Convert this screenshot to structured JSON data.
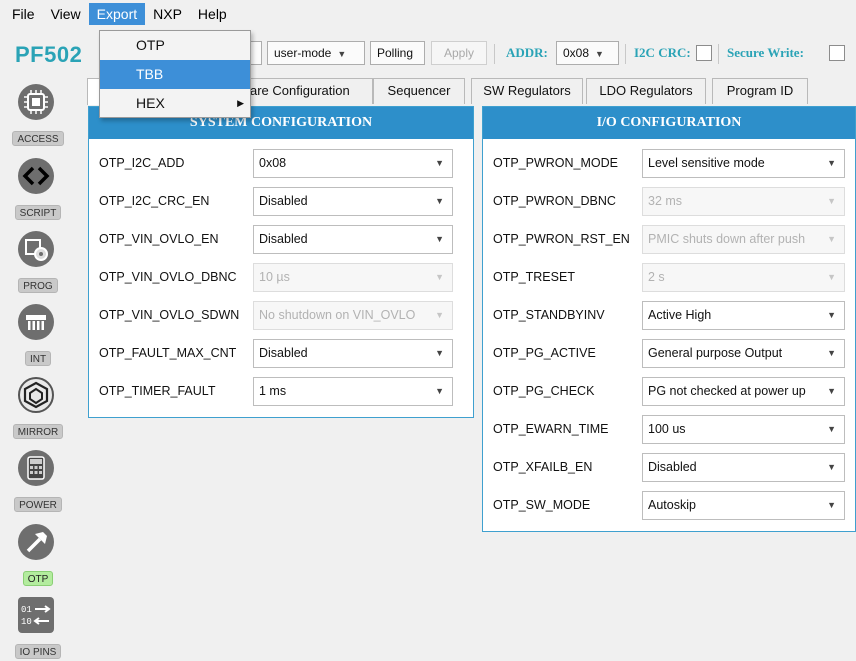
{
  "menu": {
    "items": [
      "File",
      "View",
      "Export",
      "NXP",
      "Help"
    ],
    "active": "Export"
  },
  "export_menu": {
    "items": [
      {
        "label": "OTP",
        "highlighted": false,
        "submenu": false
      },
      {
        "label": "TBB",
        "highlighted": true,
        "submenu": false
      },
      {
        "label": "HEX",
        "highlighted": false,
        "submenu": true
      }
    ]
  },
  "toolbar": {
    "brand": "PF502",
    "mode_select": "user-mode",
    "polling_button": "Polling",
    "apply_button": "Apply",
    "addr_label": "ADDR:",
    "addr_value": "0x08",
    "i2c_crc_label": "I2C CRC:",
    "i2c_crc_checked": false,
    "secure_write_label": "Secure Write:",
    "secure_write_checked": false
  },
  "sidebar": {
    "items": [
      {
        "label": "ACCESS",
        "icon": "chip-icon",
        "selected": false
      },
      {
        "label": "SCRIPT",
        "icon": "code-brackets-icon",
        "selected": false
      },
      {
        "label": "PROG",
        "icon": "gear-chip-icon",
        "selected": false
      },
      {
        "label": "INT",
        "icon": "pins-icon",
        "selected": false
      },
      {
        "label": "MIRROR",
        "icon": "mirror-icon",
        "selected": false
      },
      {
        "label": "POWER",
        "icon": "calculator-icon",
        "selected": false
      },
      {
        "label": "OTP",
        "icon": "hammer-icon",
        "selected": true
      },
      {
        "label": "IO PINS",
        "icon": "io-arrows-icon",
        "selected": false
      }
    ]
  },
  "tabs": [
    {
      "label": "",
      "active": true
    },
    {
      "label": "are Configuration",
      "active": false
    },
    {
      "label": "Sequencer",
      "active": false
    },
    {
      "label": "SW Regulators",
      "active": false
    },
    {
      "label": "LDO Regulators",
      "active": false
    },
    {
      "label": "Program ID",
      "active": false
    }
  ],
  "system_config": {
    "title": "SYSTEM CONFIGURATION",
    "rows": [
      {
        "label": "OTP_I2C_ADD",
        "value": "0x08",
        "enabled": true
      },
      {
        "label": "OTP_I2C_CRC_EN",
        "value": "Disabled",
        "enabled": true
      },
      {
        "label": "OTP_VIN_OVLO_EN",
        "value": "Disabled",
        "enabled": true
      },
      {
        "label": "OTP_VIN_OVLO_DBNC",
        "value": "10 µs",
        "enabled": false
      },
      {
        "label": "OTP_VIN_OVLO_SDWN",
        "value": "No shutdown on VIN_OVLO",
        "enabled": false
      },
      {
        "label": "OTP_FAULT_MAX_CNT",
        "value": "Disabled",
        "enabled": true
      },
      {
        "label": "OTP_TIMER_FAULT",
        "value": "1 ms",
        "enabled": true
      }
    ]
  },
  "io_config": {
    "title": "I/O CONFIGURATION",
    "rows": [
      {
        "label": "OTP_PWRON_MODE",
        "value": "Level sensitive mode",
        "enabled": true
      },
      {
        "label": "OTP_PWRON_DBNC",
        "value": "32 ms",
        "enabled": false
      },
      {
        "label": "OTP_PWRON_RST_EN",
        "value": "PMIC shuts down after push",
        "enabled": false
      },
      {
        "label": "OTP_TRESET",
        "value": "2 s",
        "enabled": false
      },
      {
        "label": "OTP_STANDBYINV",
        "value": "Active High",
        "enabled": true
      },
      {
        "label": "OTP_PG_ACTIVE",
        "value": "General purpose Output",
        "enabled": true
      },
      {
        "label": "OTP_PG_CHECK",
        "value": "PG not checked at power up",
        "enabled": true
      },
      {
        "label": "OTP_EWARN_TIME",
        "value": "100 us",
        "enabled": true
      },
      {
        "label": "OTP_XFAILB_EN",
        "value": "Disabled",
        "enabled": true
      },
      {
        "label": "OTP_SW_MODE",
        "value": "Autoskip",
        "enabled": true
      }
    ]
  },
  "colors": {
    "accent": "#2d8fca",
    "brand": "#2aa3b6",
    "menu_highlight": "#3d8fd8",
    "selected_sidebar": "#b3ec9e"
  }
}
